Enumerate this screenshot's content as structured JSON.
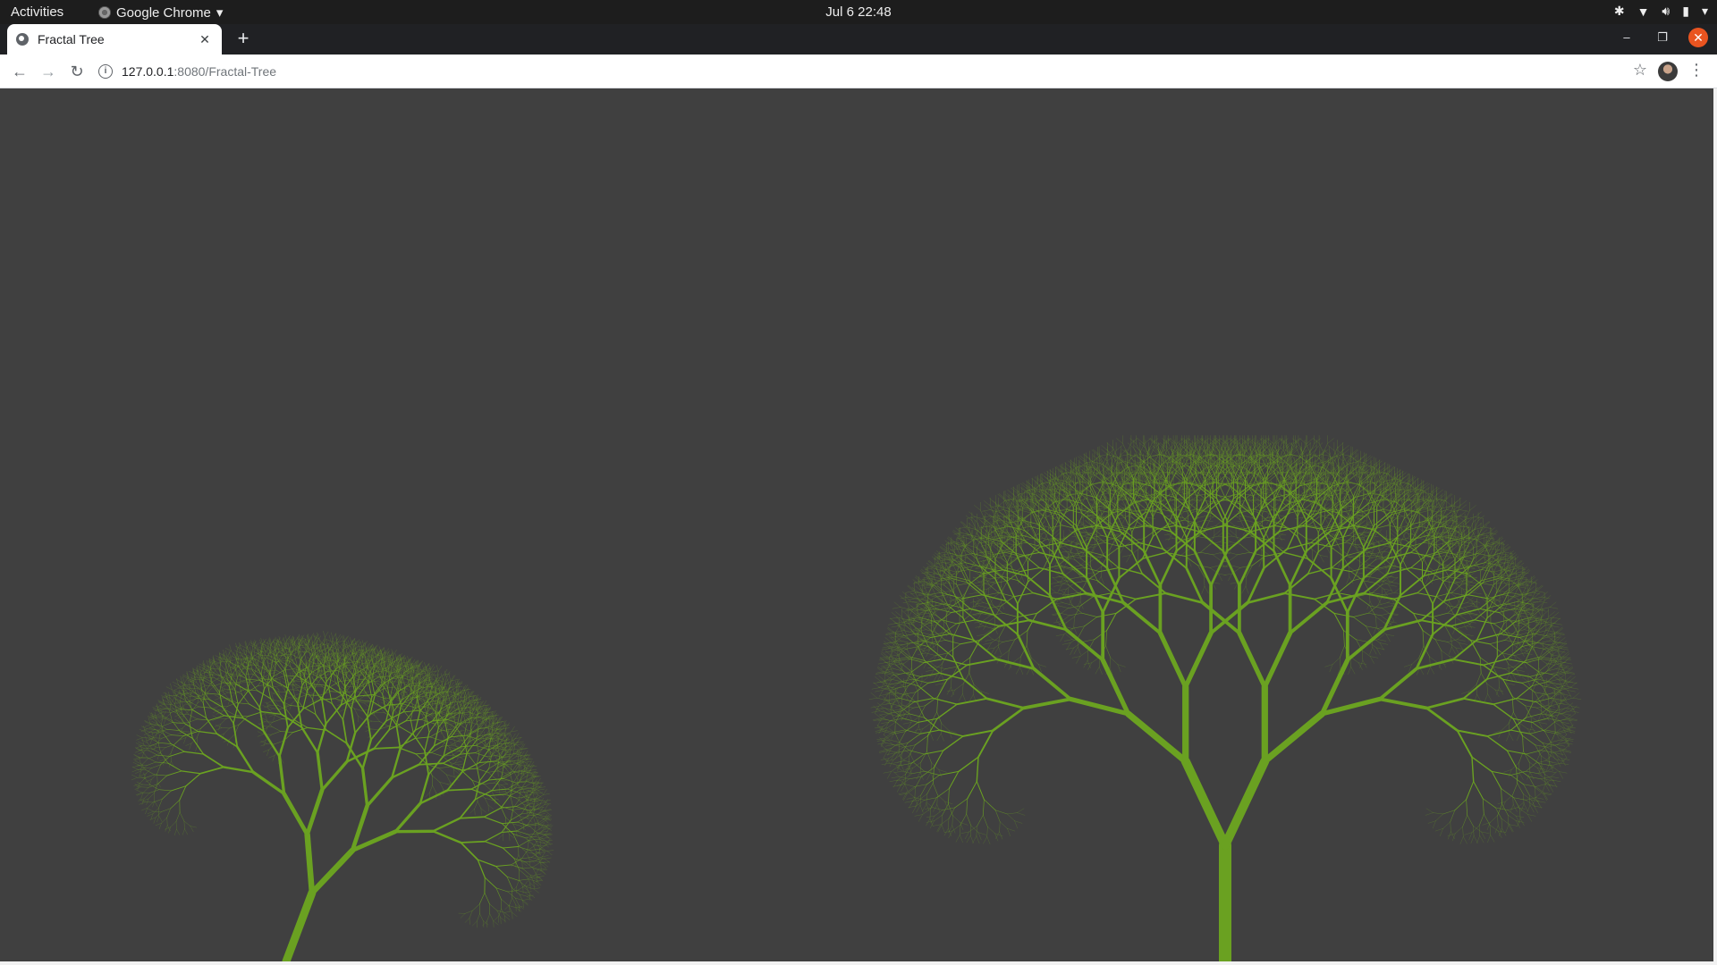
{
  "os_bar": {
    "activities": "Activities",
    "app_name": "Google Chrome",
    "clock": "Jul 6  22:48"
  },
  "browser": {
    "tab_title": "Fractal Tree",
    "url_host": "127.0.0.1",
    "url_path": ":8080/Fractal-Tree",
    "new_tab_symbol": "+",
    "close_tab_symbol": "✕"
  },
  "icons": {
    "back": "arrow-left-icon",
    "forward": "arrow-right-icon",
    "reload": "reload-icon",
    "info": "info-icon",
    "bookmark": "star-icon",
    "menu": "kebab-menu-icon"
  },
  "scene": {
    "background_color": "#404040",
    "branch_color": "#6aa121",
    "trees": [
      {
        "name": "small-tree"
      },
      {
        "name": "large-tree"
      }
    ]
  }
}
